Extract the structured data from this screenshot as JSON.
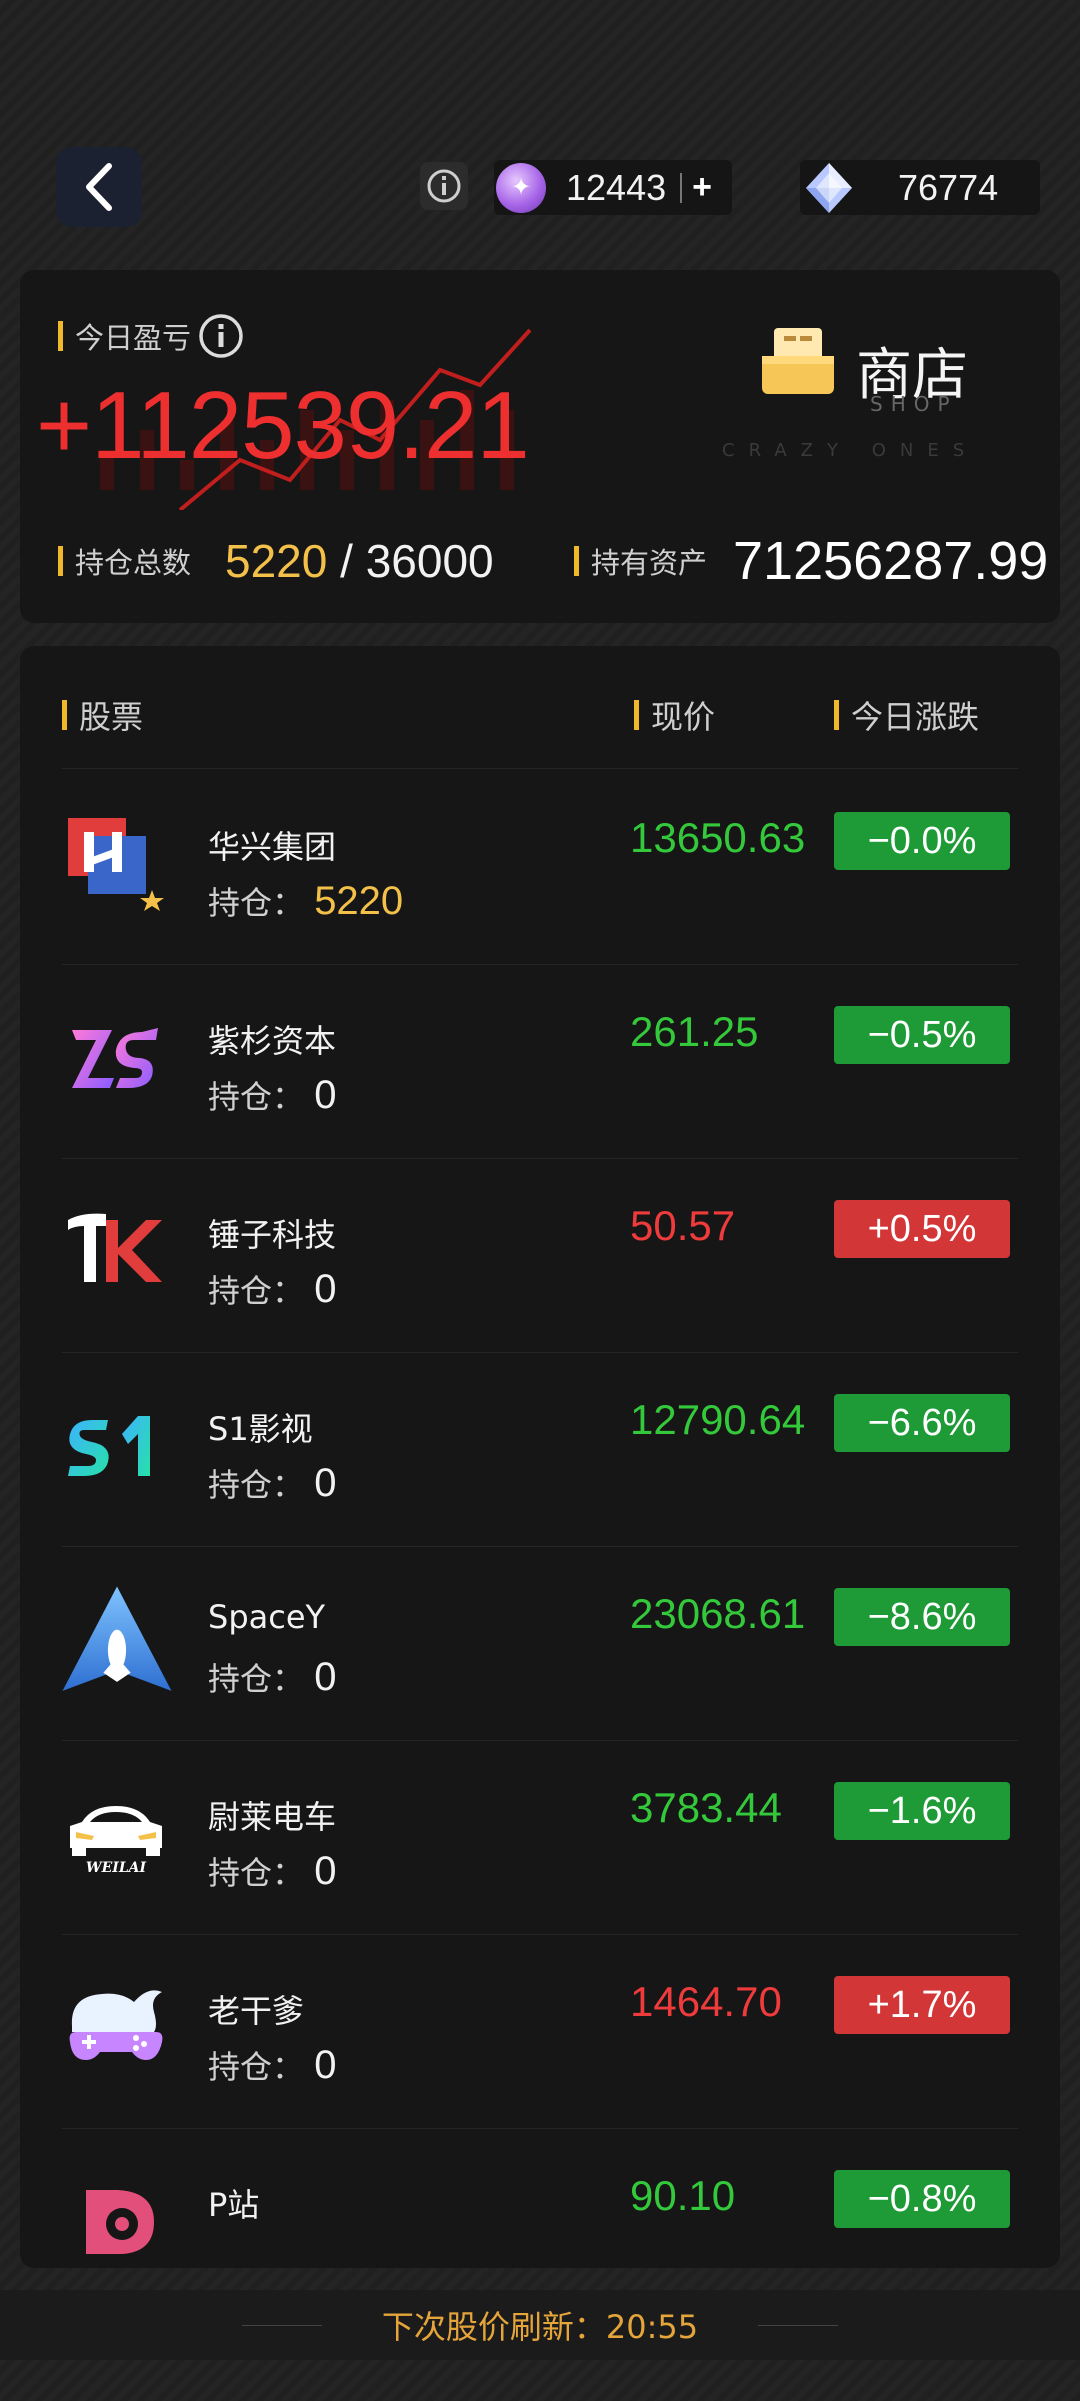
{
  "topbar": {
    "coin_balance": "12443",
    "gem_balance": "76774",
    "plus_label": "+"
  },
  "summary": {
    "pnl_label": "今日盈亏",
    "pnl_value": "+112539.21",
    "holdings_label": "持仓总数",
    "holdings_current": "5220",
    "holdings_sep": " / ",
    "holdings_max": "36000",
    "assets_label": "持有资产",
    "assets_value": "71256287.99"
  },
  "shop": {
    "title": "商店",
    "subtitle": "SHOP",
    "watermark": "CRAZY ONES"
  },
  "list": {
    "header_stock": "股票",
    "header_price": "现价",
    "header_change": "今日涨跌",
    "hold_label": "持仓：",
    "stocks": [
      {
        "name": "华兴集团",
        "holding": "5220",
        "price": "13650.63",
        "change": "−0.0%",
        "direction": "down",
        "logo": "huaxing-logo"
      },
      {
        "name": "紫杉资本",
        "holding": "0",
        "price": "261.25",
        "change": "−0.5%",
        "direction": "down",
        "logo": "zs-logo"
      },
      {
        "name": "锤子科技",
        "holding": "0",
        "price": "50.57",
        "change": "+0.5%",
        "direction": "up",
        "logo": "hammer-logo"
      },
      {
        "name": "S1影视",
        "holding": "0",
        "price": "12790.64",
        "change": "−6.6%",
        "direction": "down",
        "logo": "s1-logo"
      },
      {
        "name": "SpaceY",
        "holding": "0",
        "price": "23068.61",
        "change": "−8.6%",
        "direction": "down",
        "logo": "rocket-logo"
      },
      {
        "name": "尉莱电车",
        "holding": "0",
        "price": "3783.44",
        "change": "−1.6%",
        "direction": "down",
        "logo": "car-logo"
      },
      {
        "name": "老干爹",
        "holding": "0",
        "price": "1464.70",
        "change": "+1.7%",
        "direction": "up",
        "logo": "gamepad-logo"
      },
      {
        "name": "P站",
        "holding": "",
        "price": "90.10",
        "change": "−0.8%",
        "direction": "down",
        "logo": "p-logo"
      }
    ],
    "car_logo_text": "WEILAI"
  },
  "footer": {
    "refresh_label": "下次股价刷新：",
    "refresh_time": "20:55"
  },
  "colors": {
    "up": "#ef3b3b",
    "down": "#34c93b",
    "accent": "#f0b92a"
  }
}
